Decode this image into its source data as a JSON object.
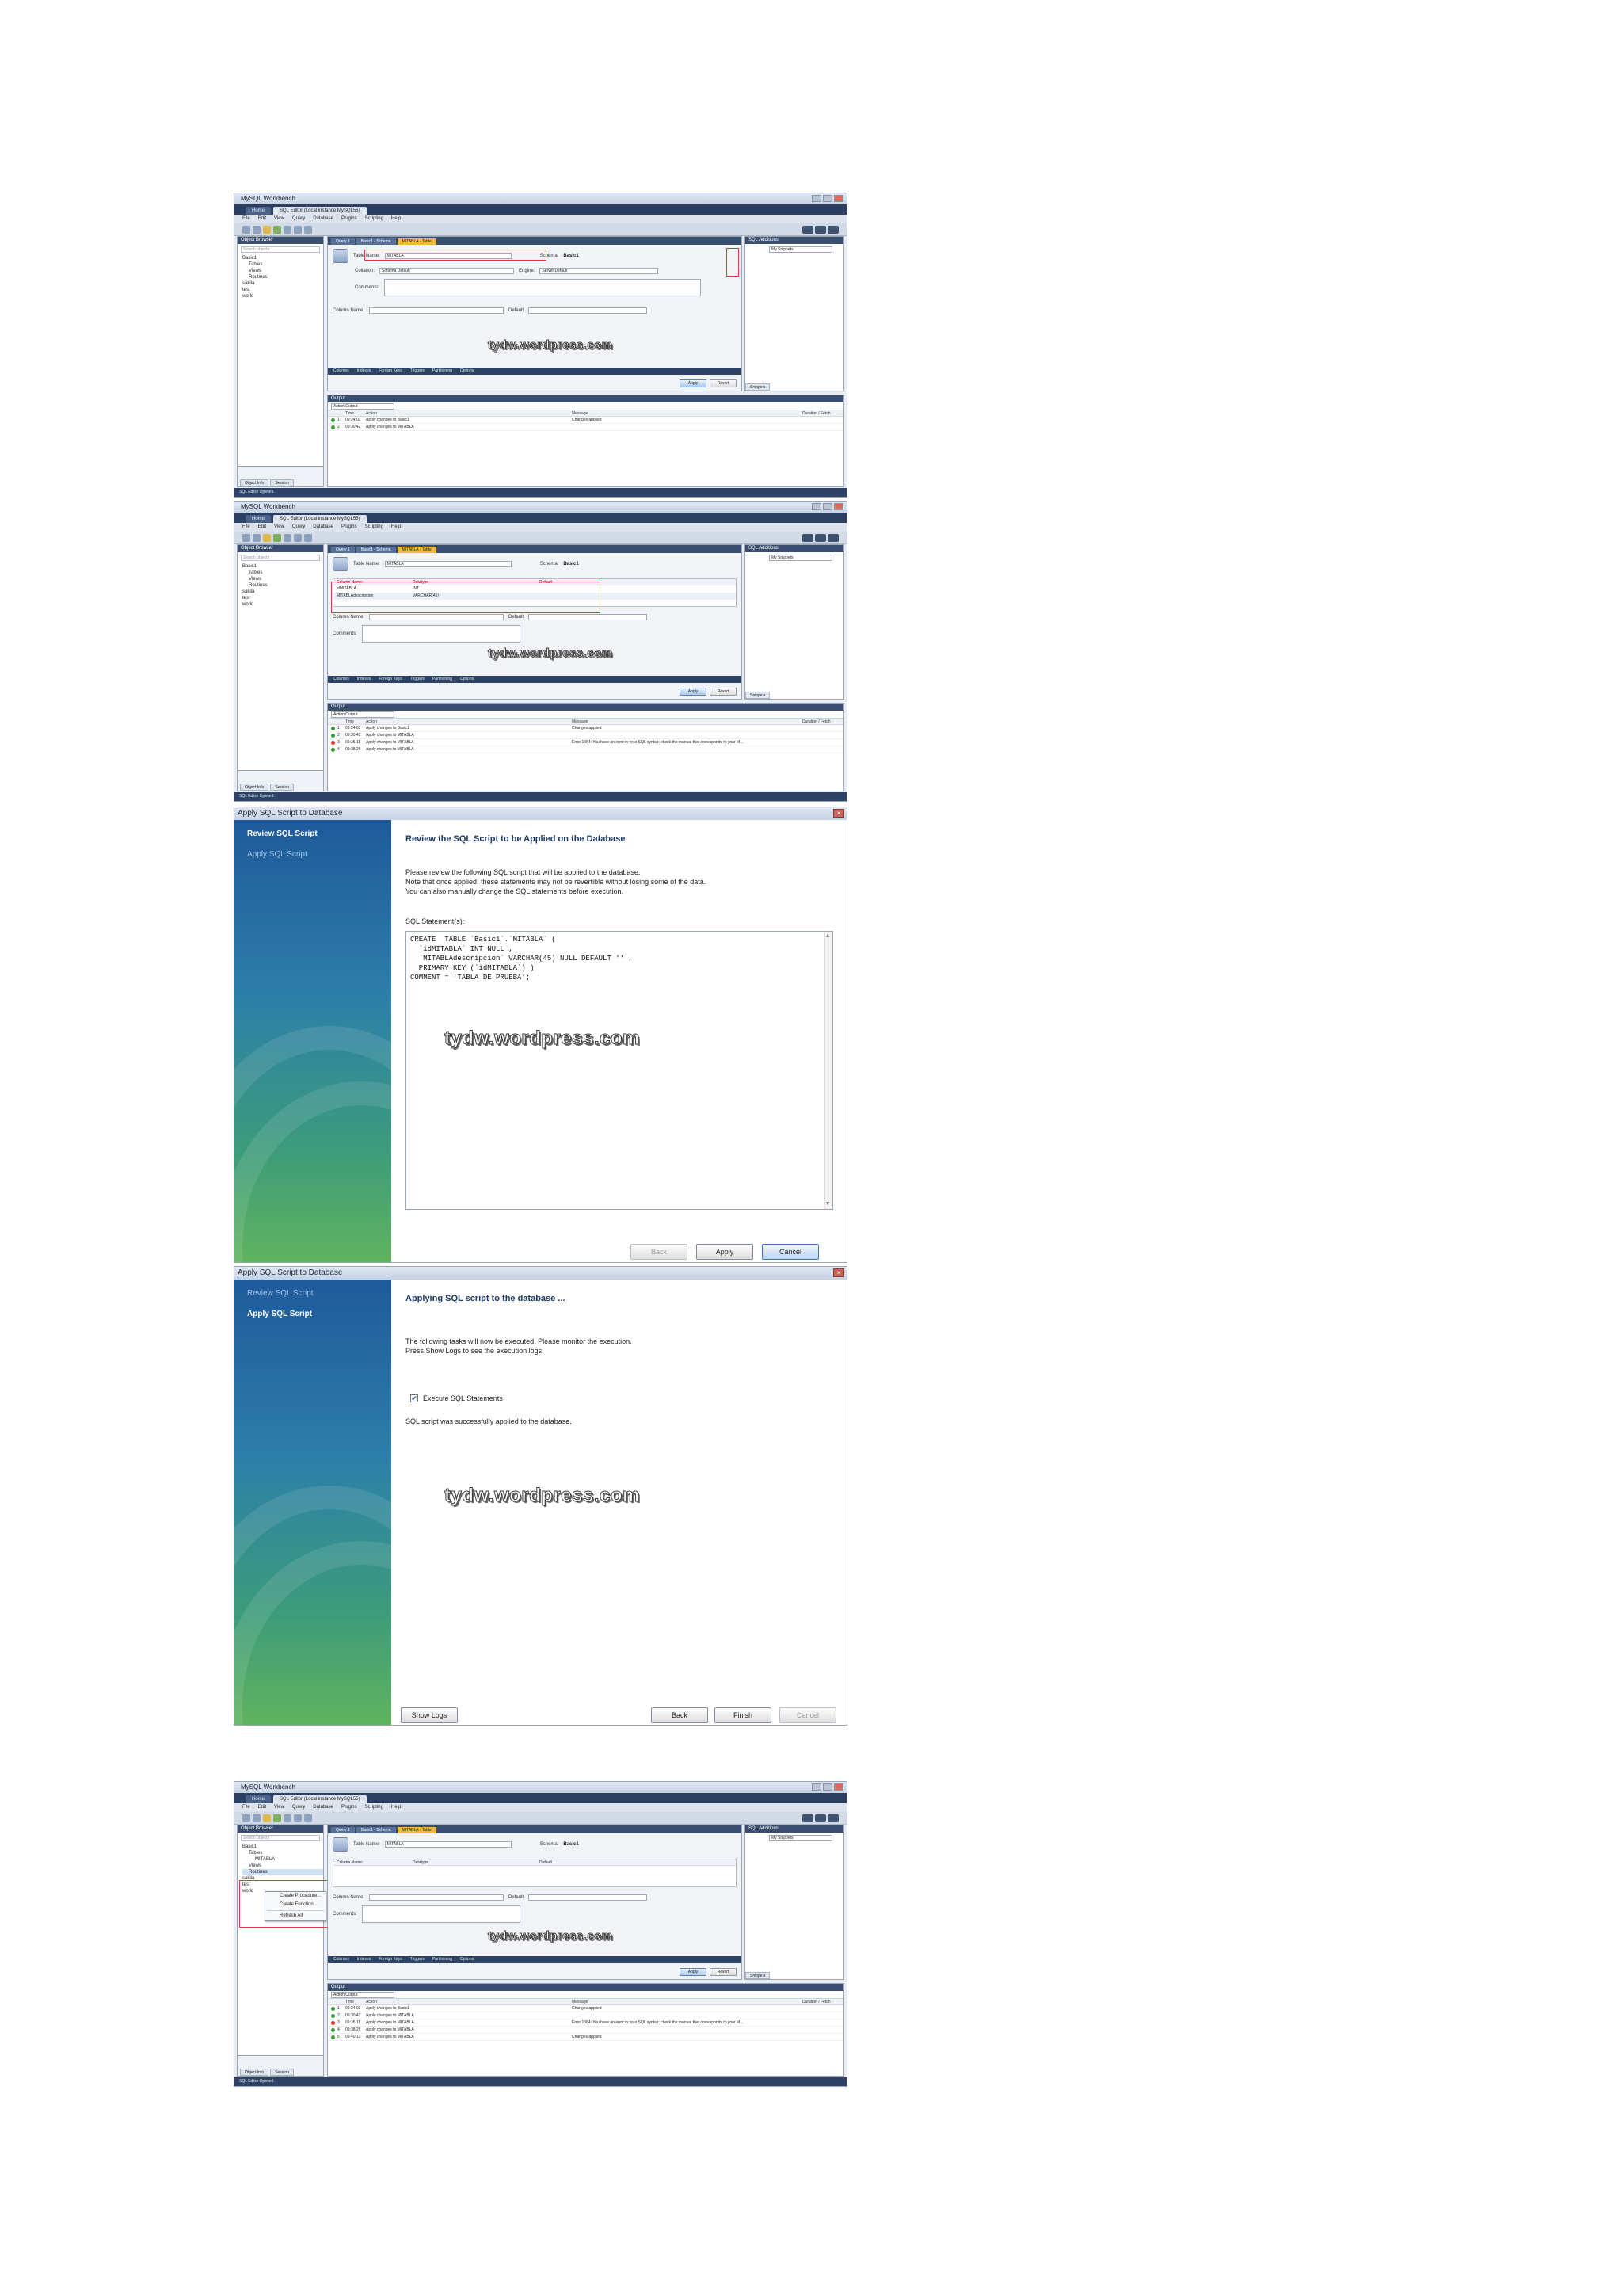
{
  "watermark": "tydw.wordpress.com",
  "wb": {
    "title": "MySQL Workbench",
    "tabs": [
      "Home",
      "SQL Editor (Local instance MySQL55)"
    ],
    "menu": [
      "File",
      "Edit",
      "View",
      "Query",
      "Database",
      "Plugins",
      "Scripting",
      "Help"
    ],
    "object_browser": "Object Browser",
    "search_placeholder": "Search objects",
    "info_tabs": [
      "Object Info",
      "Session"
    ],
    "editor_tabs": [
      "Query 1",
      "Basic1 - Schema",
      "MITABLA - Table"
    ],
    "snippets": "SQL Additions",
    "snippets_select": "My Snippets",
    "snippets_tab": "Snippets",
    "output": "Output",
    "output_select": "Action Output",
    "status": "SQL Editor Opened.",
    "table_name_label": "Table Name:",
    "schema_label": "Schema:",
    "schema_value": "Basic1",
    "collation_label": "Collation:",
    "collation_value": "Schema Default",
    "engine_label": "Engine:",
    "engine_value": "Server Default",
    "comments_label": "Comments:",
    "column_name_label": "Column Name:",
    "datatype_label": "Datatype",
    "default_label": "Default",
    "bottom_tabs": [
      "Columns",
      "Indexes",
      "Foreign Keys",
      "Triggers",
      "Partitioning",
      "Options"
    ],
    "apply": "Apply",
    "revert": "Revert",
    "out_headers": [
      "",
      "Time",
      "Action",
      "Message",
      "Duration / Fetch"
    ],
    "table_name_value": "MITABLA",
    "columns": [
      {
        "name": "idMITABLA",
        "type": "INT"
      },
      {
        "name": "MITABLAdescripcion",
        "type": "VARCHAR(45)"
      }
    ],
    "ctx_items": [
      "Create Procedure...",
      "Create Function...",
      "Refresh All"
    ],
    "tree_a": [
      "Basic1",
      "Tables",
      "Views",
      "Routines",
      "sakila",
      "test",
      "world"
    ],
    "tree_b": [
      "Basic1",
      "Tables",
      "MITABLA",
      "Views",
      "Routines",
      "sakila",
      "test",
      "world"
    ],
    "out_a": [
      {
        "n": "1",
        "t": "09:24:02",
        "a": "Apply changes to Basic1",
        "m": "Changes applied",
        "err": false
      },
      {
        "n": "2",
        "t": "09:30:42",
        "a": "Apply changes to MITABLA",
        "m": "",
        "err": false
      }
    ],
    "out_b": [
      {
        "n": "1",
        "t": "09:24:02",
        "a": "Apply changes to Basic1",
        "m": "Changes applied",
        "err": false
      },
      {
        "n": "2",
        "t": "09:30:42",
        "a": "Apply changes to MITABLA",
        "m": "",
        "err": false
      },
      {
        "n": "3",
        "t": "09:35:11",
        "a": "Apply changes to MITABLA",
        "m": "Error 1064: You have an error in your SQL syntax; check the manual that corresponds to your M...",
        "err": true
      },
      {
        "n": "4",
        "t": "09:38:26",
        "a": "Apply changes to MITABLA",
        "m": "",
        "err": false
      }
    ],
    "out_c": [
      {
        "n": "1",
        "t": "09:24:02",
        "a": "Apply changes to Basic1",
        "m": "Changes applied",
        "err": false
      },
      {
        "n": "2",
        "t": "09:30:42",
        "a": "Apply changes to MITABLA",
        "m": "",
        "err": false
      },
      {
        "n": "3",
        "t": "09:35:11",
        "a": "Apply changes to MITABLA",
        "m": "Error 1064: You have an error in your SQL syntax; check the manual that corresponds to your M...",
        "err": true
      },
      {
        "n": "4",
        "t": "09:38:26",
        "a": "Apply changes to MITABLA",
        "m": "",
        "err": false
      },
      {
        "n": "5",
        "t": "09:40:13",
        "a": "Apply changes to MITABLA",
        "m": "Changes applied",
        "err": false
      }
    ]
  },
  "wizard1": {
    "title": "Apply SQL Script to Database",
    "steps": [
      "Review SQL Script",
      "Apply SQL Script"
    ],
    "heading": "Review the SQL Script to be Applied on the Database",
    "para": "Please review the following SQL script that will be applied to the database.\nNote that once applied, these statements may not be revertible without losing some of the data.\nYou can also manually change the SQL statements before execution.",
    "sql_label": "SQL Statement(s):",
    "sql": "CREATE  TABLE `Basic1`.`MITABLA` (\n  `idMITABLA` INT NULL ,\n  `MITABLAdescripcion` VARCHAR(45) NULL DEFAULT '' ,\n  PRIMARY KEY (`idMITABLA`) )\nCOMMENT = 'TABLA DE PRUEBA';",
    "back": "Back",
    "apply": "Apply",
    "cancel": "Cancel"
  },
  "wizard2": {
    "title": "Apply SQL Script to Database",
    "steps": [
      "Review SQL Script",
      "Apply SQL Script"
    ],
    "heading": "Applying SQL script to the database ...",
    "para": "The following tasks will now be executed. Please monitor the execution.\nPress Show Logs to see the execution logs.",
    "task": "Execute SQL Statements",
    "result": "SQL script was successfully applied to the database.",
    "show_logs": "Show Logs",
    "back": "Back",
    "finish": "Finish",
    "cancel": "Cancel"
  }
}
